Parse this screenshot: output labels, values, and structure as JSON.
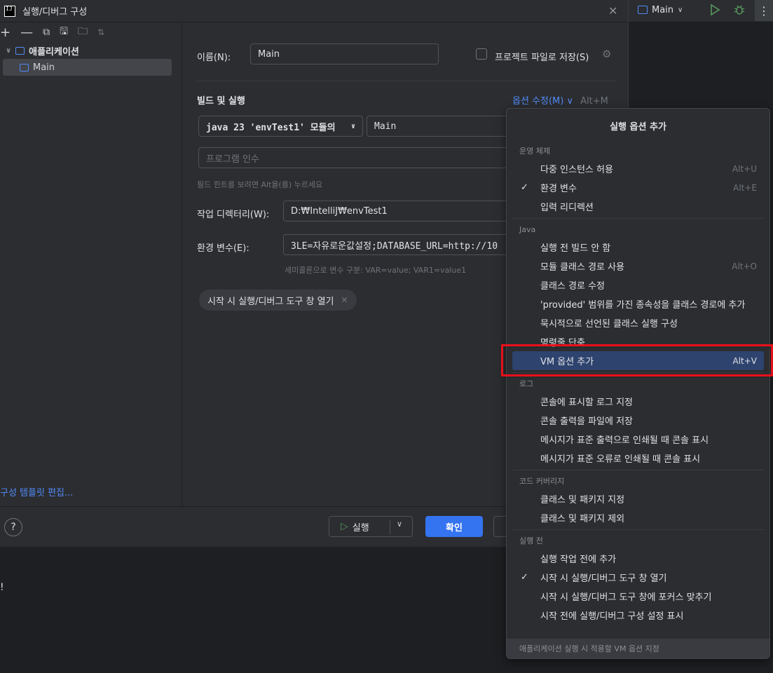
{
  "dialog": {
    "title": "실행/디버그 구성",
    "toolbar_icons": [
      "add-icon",
      "remove-icon",
      "copy-icon",
      "save-icon",
      "move-to-folder-icon",
      "sort-icon"
    ],
    "tree": {
      "parent_label": "애플리케이션",
      "child_label": "Main"
    },
    "edit_templates_label": "구성 템플릿 편집...",
    "name_label": "이름(N):",
    "name_value": "Main",
    "store_as_project_file_label": "프로젝트 파일로 저장(S)",
    "build_run_title": "빌드 및 실행",
    "modify_options_label": "옵션 수정(M)",
    "modify_options_shortcut": "Alt+M",
    "jdk_value": "java 23 'envTest1' 모듈의",
    "main_class_value": "Main",
    "program_args_placeholder": "프로그램 인수",
    "field_hint": "필드 힌트를 보려면 Alt을(를) 누르세요",
    "workdir_label": "작업 디렉터리(W):",
    "workdir_value": "D:₩IntelliJ₩envTest1",
    "envvars_label": "환경 변수(E):",
    "envvars_value": "3LE=자유로운값설정;DATABASE_URL=http://10",
    "envvars_hint": "세미콜론으로 변수 구분: VAR=value; VAR1=value1",
    "chip_label": "시작 시 실행/디버그 도구 창 열기",
    "run_button_label": "실행",
    "ok_button_label": "확인",
    "help_label": "?"
  },
  "ide": {
    "run_config_label": "Main",
    "stray_text": "!"
  },
  "popup": {
    "title": "실행 옵션 추가",
    "groups": [
      {
        "name": "운영 체제",
        "items": [
          {
            "label": "다중 인스턴스 허용",
            "shortcut": "Alt+U",
            "checked": false
          },
          {
            "label": "환경 변수",
            "shortcut": "Alt+E",
            "checked": true
          },
          {
            "label": "입력 리디렉션",
            "shortcut": "",
            "checked": false
          }
        ]
      },
      {
        "name": "Java",
        "items": [
          {
            "label": "실행 전 빌드 안 함",
            "shortcut": "",
            "checked": false
          },
          {
            "label": "모듈 클래스 경로 사용",
            "shortcut": "Alt+O",
            "checked": false
          },
          {
            "label": "클래스 경로 수정",
            "shortcut": "",
            "checked": false
          },
          {
            "label": "'provided' 범위를 가진 종속성을 클래스 경로에 추가",
            "shortcut": "",
            "checked": false
          },
          {
            "label": "묵시적으로 선언된 클래스 실행 구성",
            "shortcut": "",
            "checked": false
          },
          {
            "label": "명령줄 단축",
            "shortcut": "",
            "checked": false
          },
          {
            "label": "VM 옵션 추가",
            "shortcut": "Alt+V",
            "checked": false,
            "selected": true
          }
        ]
      },
      {
        "name": "로그",
        "items": [
          {
            "label": "콘솔에 표시할 로그 지정",
            "shortcut": "",
            "checked": false
          },
          {
            "label": "콘솔 출력을 파일에 저장",
            "shortcut": "",
            "checked": false
          },
          {
            "label": "메시지가 표준 출력으로 인쇄될 때 콘솔 표시",
            "shortcut": "",
            "checked": false
          },
          {
            "label": "메시지가 표준 오류로 인쇄될 때 콘솔 표시",
            "shortcut": "",
            "checked": false
          }
        ]
      },
      {
        "name": "코드 커버리지",
        "items": [
          {
            "label": "클래스 및 패키지 지정",
            "shortcut": "",
            "checked": false
          },
          {
            "label": "클래스 및 패키지 제외",
            "shortcut": "",
            "checked": false
          }
        ]
      },
      {
        "name": "실행 전",
        "items": [
          {
            "label": "실행 작업 전에 추가",
            "shortcut": "",
            "checked": false
          },
          {
            "label": "시작 시 실행/디버그 도구 창 열기",
            "shortcut": "",
            "checked": true
          },
          {
            "label": "시작 시 실행/디버그 도구 창에 포커스 맞추기",
            "shortcut": "",
            "checked": false
          },
          {
            "label": "시작 전에 실행/디버그 구성 설정 표시",
            "shortcut": "",
            "checked": false
          }
        ]
      }
    ],
    "footer": "애플리케이션 실행 시 적용할 VM 옵션 지정"
  },
  "colors": {
    "accent": "#3574f0",
    "link": "#548af7",
    "selection": "#2e436e",
    "highlight_annotation": "#e8101a"
  }
}
